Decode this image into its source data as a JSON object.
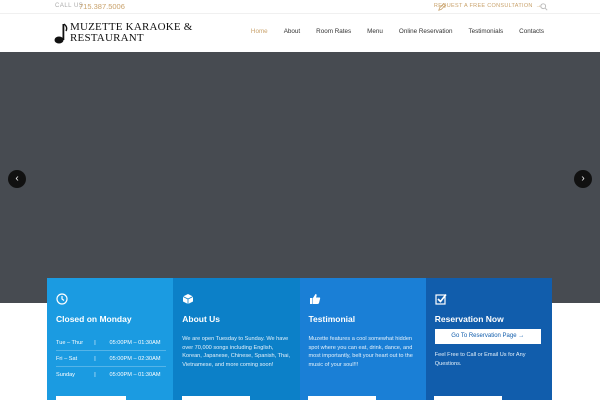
{
  "topbar": {
    "call_label": "CALL US",
    "call_number": "715.387.5006",
    "consultation": "REQUEST A FREE CONSULTATION",
    "consultation_arrow": "→",
    "accent_color": "#c9a26b"
  },
  "logo": {
    "line1": "MUZETTE KARAOKE &",
    "line2": "RESTAURANT",
    "icon": "music-note-icon"
  },
  "nav": {
    "items": [
      "Home",
      "About",
      "Room Rates",
      "Menu",
      "Online Reservation",
      "Testimonials",
      "Contacts"
    ],
    "active": "Home"
  },
  "slider": {
    "prev_label": "‹",
    "next_label": "›",
    "background": "#474b51"
  },
  "features": [
    {
      "icon": "clock-icon",
      "title": "Closed on Monday",
      "hours": [
        {
          "day": "Tue – Thur",
          "sep": "|",
          "time": "05:00PM – 01:30AM"
        },
        {
          "day": "Fri – Sat",
          "sep": "|",
          "time": "05:00PM – 02:30AM"
        },
        {
          "day": "Sunday",
          "sep": "|",
          "time": "05:00PM – 01:30AM"
        }
      ],
      "color": "#1b9be1"
    },
    {
      "icon": "cube-icon",
      "title": "About Us",
      "text": "We are open Tuesday to Sunday. We have over 70,000 songs including English, Korean, Japanese, Chinese, Spanish, Thai, Vietnamese, and more coming soon!",
      "color": "#0c80c8"
    },
    {
      "icon": "thumbs-up-icon",
      "title": "Testimonial",
      "text": "Muzette features a cool somewhat hidden spot where you can eat, drink, dance, and most importantly, belt your heart out to the music of your soul!!!",
      "color": "#1a7fd6"
    },
    {
      "icon": "checkbox-icon",
      "title": "Reservation Now",
      "button": "Go To Reservation Page →",
      "text": "Feel Free to Call or Email Us for Any Questions.",
      "color": "#115dac"
    }
  ]
}
